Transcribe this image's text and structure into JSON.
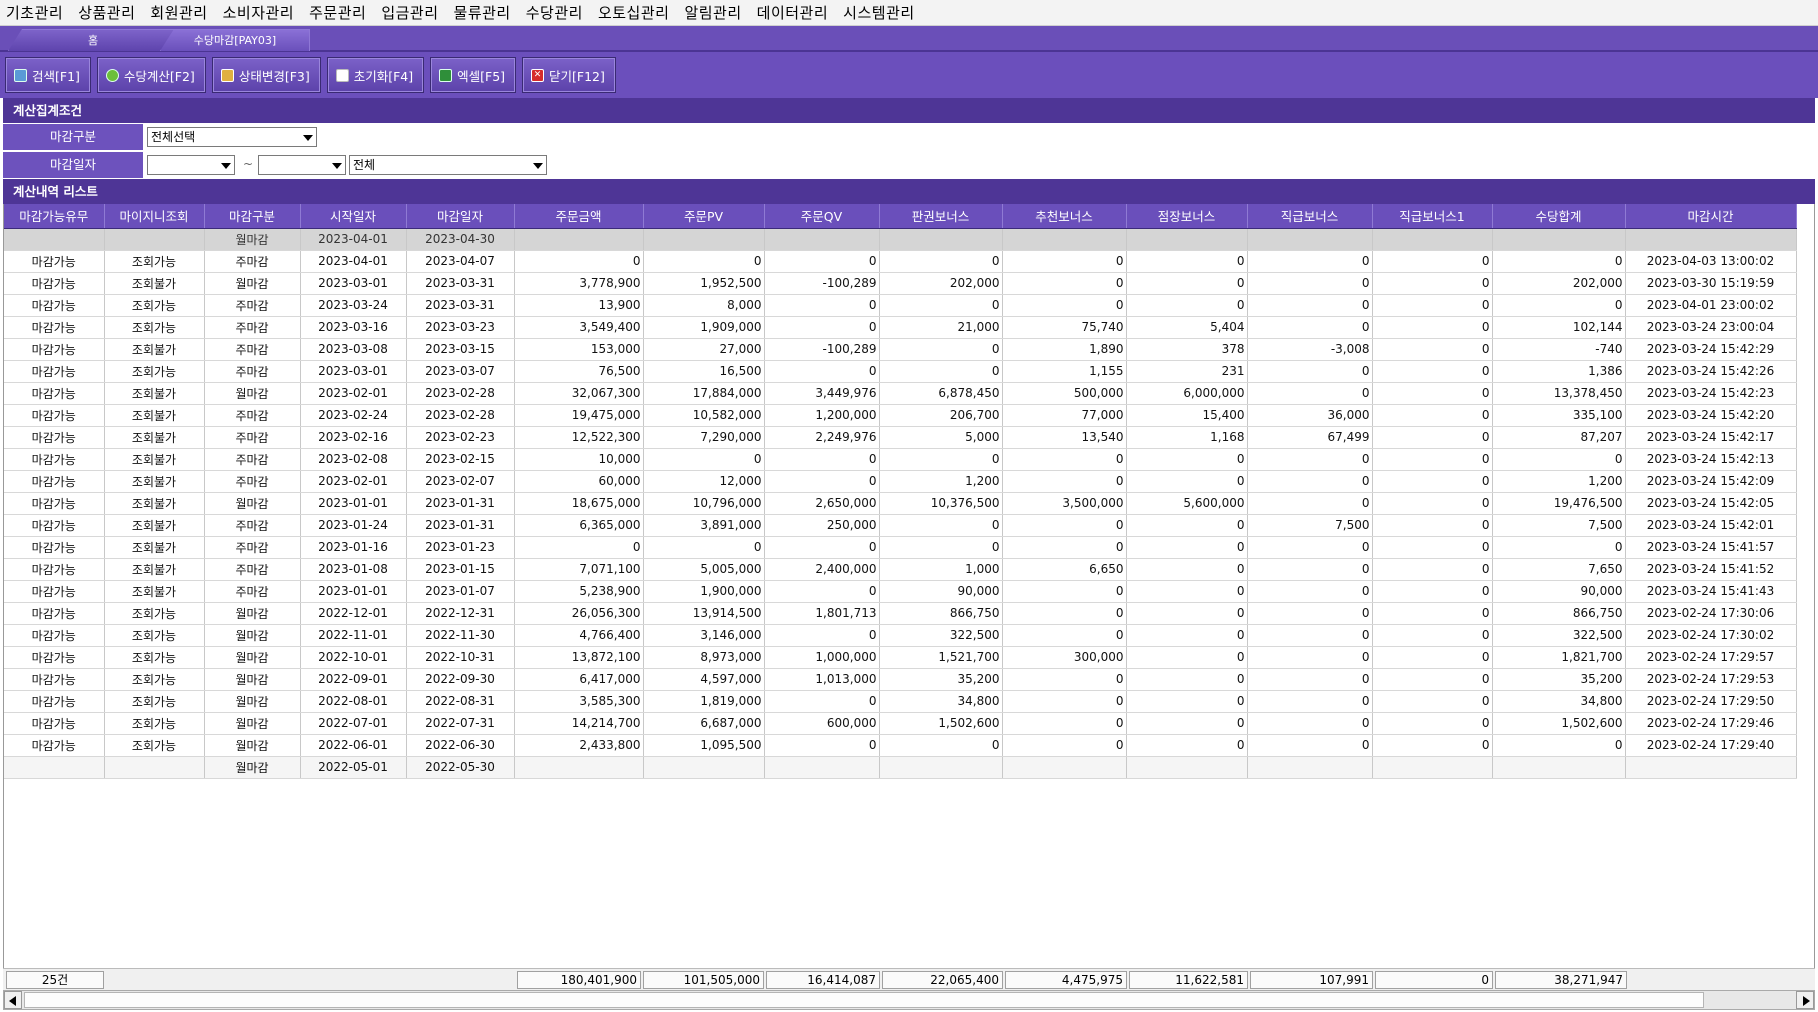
{
  "menu": [
    "기초관리",
    "상품관리",
    "회원관리",
    "소비자관리",
    "주문관리",
    "입금관리",
    "물류관리",
    "수당관리",
    "오토십관리",
    "알림관리",
    "데이터관리",
    "시스템관리"
  ],
  "tabs": {
    "home": "홈",
    "active": "수당마감[PAY03]"
  },
  "toolbar": {
    "search": "검색[F1]",
    "calc": "수당계산[F2]",
    "status": "상태변경[F3]",
    "reset": "초기화[F4]",
    "excel": "엑셀[F5]",
    "close": "닫기[F12]"
  },
  "conditions": {
    "title": "계산집계조건",
    "close_type_label": "마감구분",
    "close_type_value": "전체선택",
    "close_date_label": "마감일자",
    "date_from": "",
    "date_to": "",
    "tilde": "~",
    "scope_value": "전체"
  },
  "list": {
    "title": "계산내역 리스트",
    "columns": [
      "마감가능유무",
      "마이지니조회",
      "마감구분",
      "시작일자",
      "마감일자",
      "주문금액",
      "주문PV",
      "주문QV",
      "판권보너스",
      "추천보너스",
      "점장보너스",
      "직급보너스",
      "직급보너스1",
      "수당합계",
      "마감시간"
    ],
    "rows": [
      [
        "",
        "",
        "월마감",
        "2023-04-01",
        "2023-04-30",
        "",
        "",
        "",
        "",
        "",
        "",
        "",
        "",
        "",
        ""
      ],
      [
        "마감가능",
        "조회가능",
        "주마감",
        "2023-04-01",
        "2023-04-07",
        "0",
        "0",
        "0",
        "0",
        "0",
        "0",
        "0",
        "0",
        "0",
        "2023-04-03 13:00:02"
      ],
      [
        "마감가능",
        "조회불가",
        "월마감",
        "2023-03-01",
        "2023-03-31",
        "3,778,900",
        "1,952,500",
        "-100,289",
        "202,000",
        "0",
        "0",
        "0",
        "0",
        "202,000",
        "2023-03-30 15:19:59"
      ],
      [
        "마감가능",
        "조회가능",
        "주마감",
        "2023-03-24",
        "2023-03-31",
        "13,900",
        "8,000",
        "0",
        "0",
        "0",
        "0",
        "0",
        "0",
        "0",
        "2023-04-01 23:00:02"
      ],
      [
        "마감가능",
        "조회가능",
        "주마감",
        "2023-03-16",
        "2023-03-23",
        "3,549,400",
        "1,909,000",
        "0",
        "21,000",
        "75,740",
        "5,404",
        "0",
        "0",
        "102,144",
        "2023-03-24 23:00:04"
      ],
      [
        "마감가능",
        "조회불가",
        "주마감",
        "2023-03-08",
        "2023-03-15",
        "153,000",
        "27,000",
        "-100,289",
        "0",
        "1,890",
        "378",
        "-3,008",
        "0",
        "-740",
        "2023-03-24 15:42:29"
      ],
      [
        "마감가능",
        "조회가능",
        "주마감",
        "2023-03-01",
        "2023-03-07",
        "76,500",
        "16,500",
        "0",
        "0",
        "1,155",
        "231",
        "0",
        "0",
        "1,386",
        "2023-03-24 15:42:26"
      ],
      [
        "마감가능",
        "조회불가",
        "월마감",
        "2023-02-01",
        "2023-02-28",
        "32,067,300",
        "17,884,000",
        "3,449,976",
        "6,878,450",
        "500,000",
        "6,000,000",
        "0",
        "0",
        "13,378,450",
        "2023-03-24 15:42:23"
      ],
      [
        "마감가능",
        "조회불가",
        "주마감",
        "2023-02-24",
        "2023-02-28",
        "19,475,000",
        "10,582,000",
        "1,200,000",
        "206,700",
        "77,000",
        "15,400",
        "36,000",
        "0",
        "335,100",
        "2023-03-24 15:42:20"
      ],
      [
        "마감가능",
        "조회불가",
        "주마감",
        "2023-02-16",
        "2023-02-23",
        "12,522,300",
        "7,290,000",
        "2,249,976",
        "5,000",
        "13,540",
        "1,168",
        "67,499",
        "0",
        "87,207",
        "2023-03-24 15:42:17"
      ],
      [
        "마감가능",
        "조회불가",
        "주마감",
        "2023-02-08",
        "2023-02-15",
        "10,000",
        "0",
        "0",
        "0",
        "0",
        "0",
        "0",
        "0",
        "0",
        "2023-03-24 15:42:13"
      ],
      [
        "마감가능",
        "조회불가",
        "주마감",
        "2023-02-01",
        "2023-02-07",
        "60,000",
        "12,000",
        "0",
        "1,200",
        "0",
        "0",
        "0",
        "0",
        "1,200",
        "2023-03-24 15:42:09"
      ],
      [
        "마감가능",
        "조회불가",
        "월마감",
        "2023-01-01",
        "2023-01-31",
        "18,675,000",
        "10,796,000",
        "2,650,000",
        "10,376,500",
        "3,500,000",
        "5,600,000",
        "0",
        "0",
        "19,476,500",
        "2023-03-24 15:42:05"
      ],
      [
        "마감가능",
        "조회불가",
        "주마감",
        "2023-01-24",
        "2023-01-31",
        "6,365,000",
        "3,891,000",
        "250,000",
        "0",
        "0",
        "0",
        "7,500",
        "0",
        "7,500",
        "2023-03-24 15:42:01"
      ],
      [
        "마감가능",
        "조회불가",
        "주마감",
        "2023-01-16",
        "2023-01-23",
        "0",
        "0",
        "0",
        "0",
        "0",
        "0",
        "0",
        "0",
        "0",
        "2023-03-24 15:41:57"
      ],
      [
        "마감가능",
        "조회불가",
        "주마감",
        "2023-01-08",
        "2023-01-15",
        "7,071,100",
        "5,005,000",
        "2,400,000",
        "1,000",
        "6,650",
        "0",
        "0",
        "0",
        "7,650",
        "2023-03-24 15:41:52"
      ],
      [
        "마감가능",
        "조회불가",
        "주마감",
        "2023-01-01",
        "2023-01-07",
        "5,238,900",
        "1,900,000",
        "0",
        "90,000",
        "0",
        "0",
        "0",
        "0",
        "90,000",
        "2023-03-24 15:41:43"
      ],
      [
        "마감가능",
        "조회가능",
        "월마감",
        "2022-12-01",
        "2022-12-31",
        "26,056,300",
        "13,914,500",
        "1,801,713",
        "866,750",
        "0",
        "0",
        "0",
        "0",
        "866,750",
        "2023-02-24 17:30:06"
      ],
      [
        "마감가능",
        "조회가능",
        "월마감",
        "2022-11-01",
        "2022-11-30",
        "4,766,400",
        "3,146,000",
        "0",
        "322,500",
        "0",
        "0",
        "0",
        "0",
        "322,500",
        "2023-02-24 17:30:02"
      ],
      [
        "마감가능",
        "조회가능",
        "월마감",
        "2022-10-01",
        "2022-10-31",
        "13,872,100",
        "8,973,000",
        "1,000,000",
        "1,521,700",
        "300,000",
        "0",
        "0",
        "0",
        "1,821,700",
        "2023-02-24 17:29:57"
      ],
      [
        "마감가능",
        "조회가능",
        "월마감",
        "2022-09-01",
        "2022-09-30",
        "6,417,000",
        "4,597,000",
        "1,013,000",
        "35,200",
        "0",
        "0",
        "0",
        "0",
        "35,200",
        "2023-02-24 17:29:53"
      ],
      [
        "마감가능",
        "조회가능",
        "월마감",
        "2022-08-01",
        "2022-08-31",
        "3,585,300",
        "1,819,000",
        "0",
        "34,800",
        "0",
        "0",
        "0",
        "0",
        "34,800",
        "2023-02-24 17:29:50"
      ],
      [
        "마감가능",
        "조회가능",
        "월마감",
        "2022-07-01",
        "2022-07-31",
        "14,214,700",
        "6,687,000",
        "600,000",
        "1,502,600",
        "0",
        "0",
        "0",
        "0",
        "1,502,600",
        "2023-02-24 17:29:46"
      ],
      [
        "마감가능",
        "조회가능",
        "월마감",
        "2022-06-01",
        "2022-06-30",
        "2,433,800",
        "1,095,500",
        "0",
        "0",
        "0",
        "0",
        "0",
        "0",
        "0",
        "2023-02-24 17:29:40"
      ],
      [
        "",
        "",
        "월마감",
        "2022-05-01",
        "2022-05-30",
        "",
        "",
        "",
        "",
        "",
        "",
        "",
        "",
        "",
        ""
      ]
    ]
  },
  "summary": {
    "count": "25건",
    "order_amount": "180,401,900",
    "order_pv": "101,505,000",
    "order_qv": "16,414,087",
    "license_bonus": "22,065,400",
    "referral_bonus": "4,475,975",
    "manager_bonus": "11,622,581",
    "rank_bonus": "107,991",
    "rank_bonus1": "0",
    "total_allowance": "38,271,947"
  }
}
